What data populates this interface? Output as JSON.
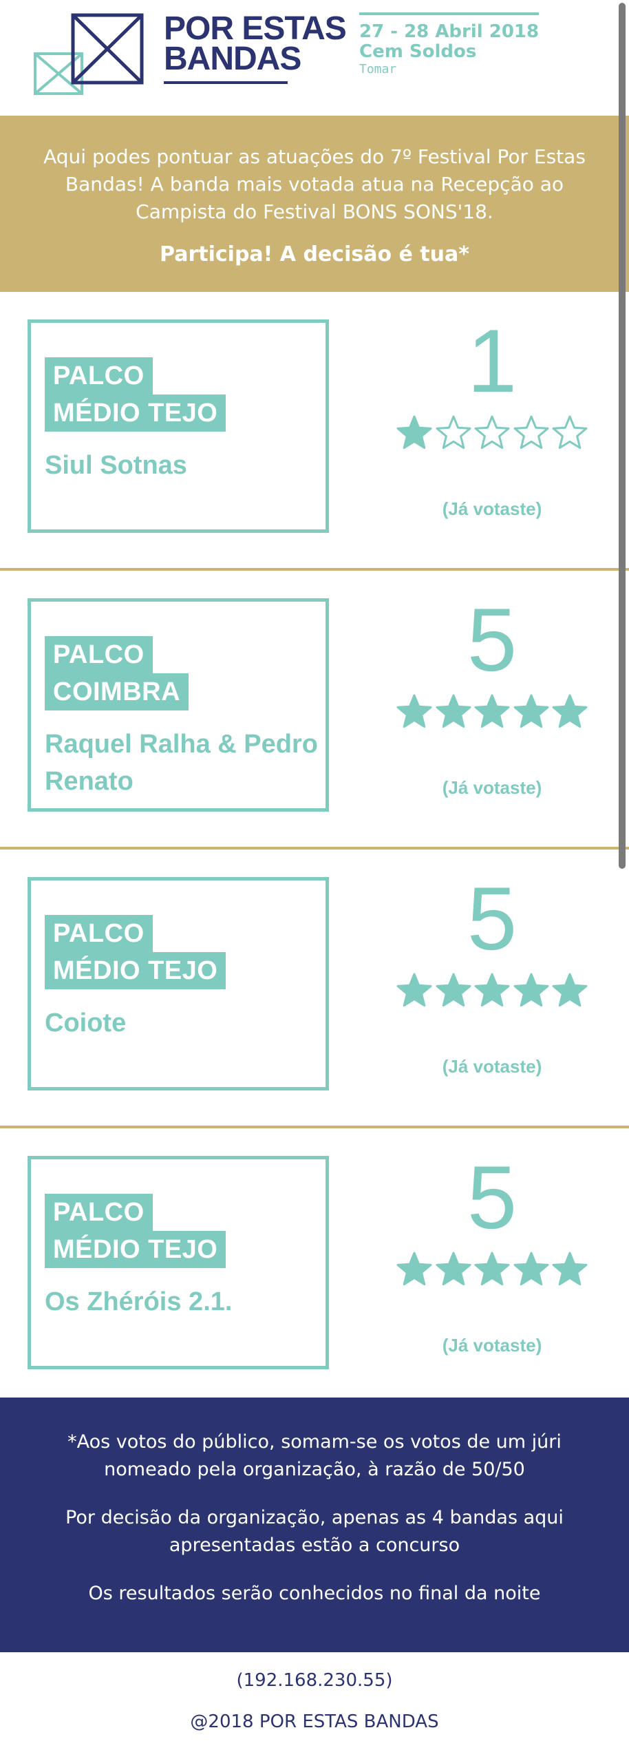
{
  "header": {
    "brand_line1": "POR ESTAS",
    "brand_line2": "BANDAS",
    "dates": "27 - 28 Abril 2018",
    "place": "Cem Soldos",
    "city": "Tomar"
  },
  "intro": {
    "text": "Aqui podes pontuar as atuações do 7º Festival Por Estas Bandas! A banda mais votada atua na Recepção ao Campista do Festival BONS SONS'18.",
    "cta": "Participa! A decisão é tua*"
  },
  "entries": [
    {
      "stage_line1": "PALCO",
      "stage_line2": "MÉDIO TEJO",
      "band": "Siul Sotnas",
      "score": "1",
      "rating": 1,
      "voted_label": "(Já votaste)"
    },
    {
      "stage_line1": "PALCO",
      "stage_line2": "COIMBRA",
      "band": "Raquel Ralha & Pedro Renato",
      "score": "5",
      "rating": 5,
      "voted_label": "(Já votaste)"
    },
    {
      "stage_line1": "PALCO",
      "stage_line2": "MÉDIO TEJO",
      "band": "Coiote",
      "score": "5",
      "rating": 5,
      "voted_label": "(Já votaste)"
    },
    {
      "stage_line1": "PALCO",
      "stage_line2": "MÉDIO TEJO",
      "band": "Os Zhéróis 2.1.",
      "score": "5",
      "rating": 5,
      "voted_label": "(Já votaste)"
    }
  ],
  "note": {
    "line1": "*Aos votos do público, somam-se os votos de um júri nomeado pela organização, à razão de 50/50",
    "line2": "Por decisão da organização, apenas as 4 bandas aqui apresentadas estão a concurso",
    "line3": "Os resultados serão conhecidos no final da noite"
  },
  "footer": {
    "ip": "(192.168.230.55)",
    "copyright": "@2018 POR ESTAS BANDAS"
  },
  "colors": {
    "teal": "#7fcbbf",
    "gold": "#cbb373",
    "navy": "#2b3470"
  }
}
